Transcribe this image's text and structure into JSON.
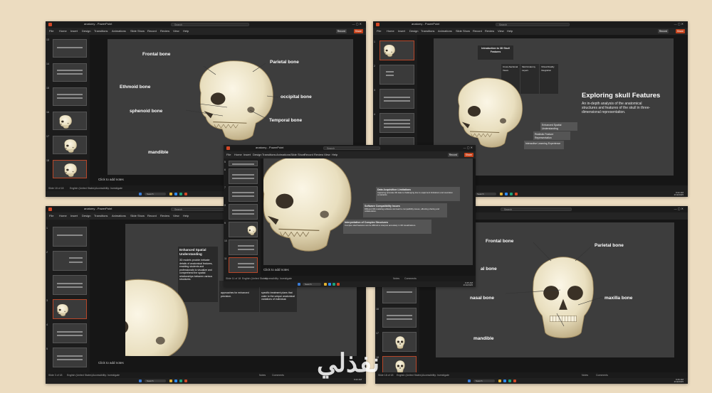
{
  "app": {
    "title": "anatomy - PowerPoint",
    "search_placeholder": "Search",
    "record": "Record",
    "share": "Share",
    "tabs": [
      "File",
      "Home",
      "Insert",
      "Design",
      "Transitions",
      "Animations",
      "Slide Show",
      "Record",
      "Review",
      "View",
      "Help"
    ],
    "notes_placeholder": "Click to add notes",
    "language": "English (United States)",
    "accessibility": "Accessibility: Investigate",
    "notes_btn": "Notes",
    "comments_btn": "Comments",
    "taskbar_search": "Search",
    "user": "0°C"
  },
  "tl": {
    "slide_status": "Slide 18 of 18",
    "clock_time": "9:19 AM",
    "clock_date": "2/19/2025",
    "labels": [
      "Frontal bone",
      "Parietal bone",
      "Ethmoid bone",
      "occipital bone",
      "sphenoid bone",
      "Temporal bone",
      "mandible"
    ],
    "thumb_numbers": [
      "13",
      "14",
      "15",
      "16",
      "17",
      "18"
    ]
  },
  "tr": {
    "title": "Exploring skull Features",
    "subtitle": "An in-depth analysis of the anatomical structures and features of the skull in three-dimensional representation.",
    "clock_time": "9:22 AM",
    "clock_date": "2/19/2025",
    "thumb_numbers": [
      "1",
      "2",
      "3",
      "4"
    ],
    "small_boxes": [
      "Introduction to 3D Skull Features",
      "Enhanced Spatial Understanding",
      "Realistic Feature Representation",
      "Interactive Learning Experience"
    ],
    "side_boxes": [
      "Cross-Sectional Views",
      "Skull Anatomy Layers",
      "Virtual Reality Integration"
    ]
  },
  "center": {
    "slide_status": "Slide 11 of 18",
    "clock_time": "9:25 AM",
    "clock_date": "2/19/2025",
    "boxes": [
      {
        "title": "Data Acquisition Limitations",
        "body": "Capturing accurate 3D data is challenging due to equipment limitations and resolution constraints."
      },
      {
        "title": "Software Compatibility Issues",
        "body": "Different 3D modeling software can lead to compatibility issues, affecting sharing and collaboration."
      },
      {
        "title": "Interpretation of Complex Structures",
        "body": "Complex skull features can be difficult to interpret accurately in 3D visualizations."
      }
    ],
    "thumb_numbers": [
      "5",
      "6",
      "7",
      "8",
      "9",
      "10",
      "11"
    ]
  },
  "bl": {
    "slide_status": "Slide 3 of 18",
    "clock_time": "9:22 AM",
    "box_title": "Enhanced Spatial Understanding",
    "box_body": "3D models provide intricate details of anatomical features, enabling students and professionals to visualize and comprehend the spatial relationships between various structures.",
    "box2": "approaches for enhanced precision.",
    "box3": "specific treatment plans that cater to the unique anatomical variations of individual.",
    "thumb_numbers": [
      "1",
      "2",
      "3",
      "4",
      "5"
    ]
  },
  "br": {
    "slide_status": "Slide 18 of 18",
    "clock_time": "9:26 AM",
    "clock_date": "2/19/2025",
    "labels": [
      "Frontal bone",
      "Parietal bone",
      "nasal bone",
      "maxilla bone",
      "mandible"
    ],
    "clipped_label": "al bone",
    "thumb_numbers": [
      "15",
      "16",
      "17",
      "18"
    ]
  },
  "watermark": "نفذلي",
  "colors": {
    "accent": "#c4421b",
    "slide_bg": "#3d3d3d",
    "app_bg": "#1f1f1f",
    "desktop": "#ecdcc0"
  }
}
